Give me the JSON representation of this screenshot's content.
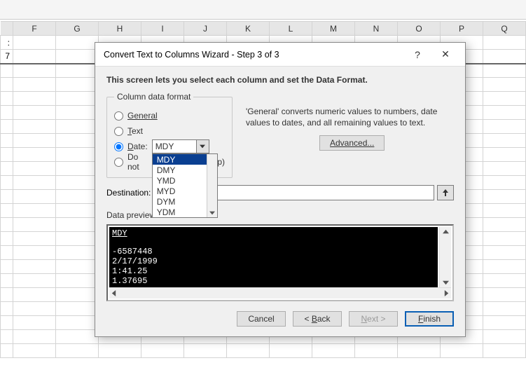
{
  "sheet": {
    "col_headers": [
      "F",
      "G",
      "H",
      "I",
      "J",
      "K",
      "L",
      "M",
      "N",
      "O",
      "P",
      "Q"
    ],
    "edge_cell_top": ":",
    "edge_cell_bottom": "7"
  },
  "dialog": {
    "title": "Convert Text to Columns Wizard - Step 3 of 3",
    "help_glyph": "?",
    "close_glyph": "✕",
    "intro": "This screen lets you select each column and set the Data Format.",
    "format_group_label": "Column data format",
    "radios": {
      "general": "General",
      "text_pre": "T",
      "text_rest": "ext",
      "date_pre": "D",
      "date_rest": "ate:",
      "skip_visible": "Do not",
      "skip_suffix": "ip)"
    },
    "date_select": {
      "value": "MDY",
      "options": [
        "MDY",
        "DMY",
        "YMD",
        "MYD",
        "DYM",
        "YDM"
      ]
    },
    "info_text": "'General' converts numeric values to numbers, date values to dates, and all remaining values to text.",
    "advanced_label": "Advanced...",
    "destination_label": "Destination:",
    "preview_label": "Data preview",
    "preview": {
      "header": "MDY",
      "lines": [
        "-6587448",
        "2/17/1999",
        "1:41.25",
        "1.37695"
      ]
    },
    "buttons": {
      "cancel": "Cancel",
      "back": "< Back",
      "next": "Next >",
      "finish": "Finish"
    }
  }
}
